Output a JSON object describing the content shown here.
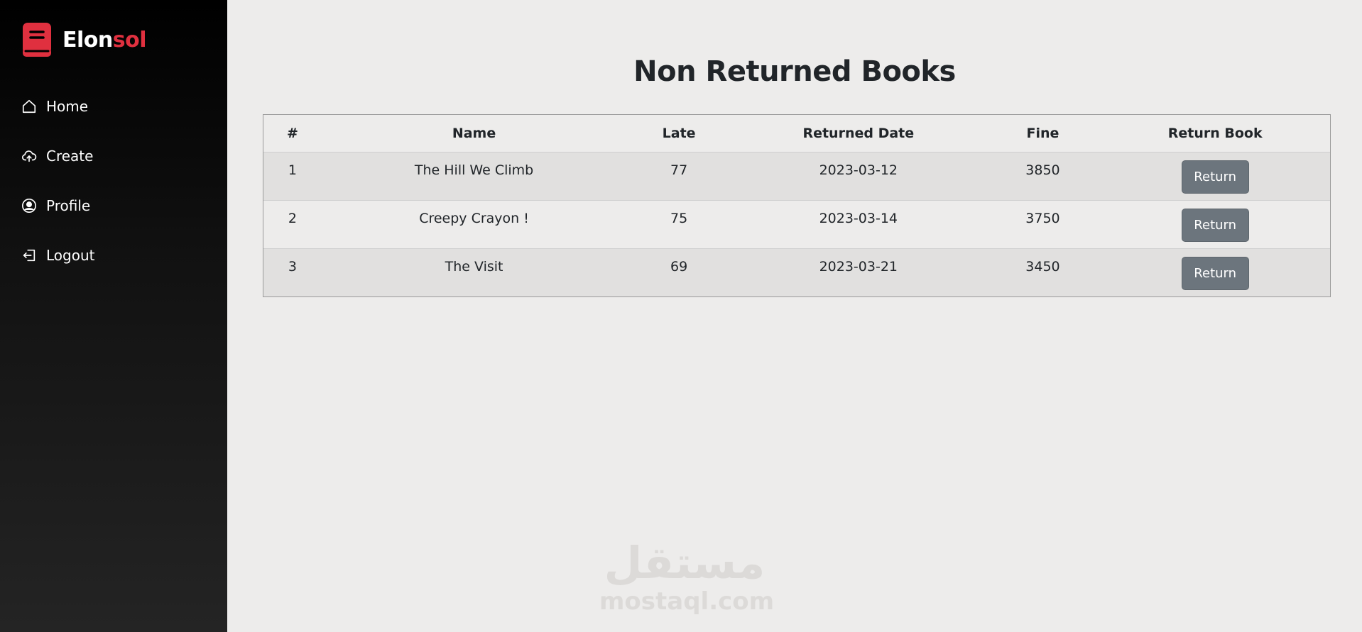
{
  "brand": {
    "name_part1": "Elon",
    "name_part2": "sol",
    "icon": "book-icon",
    "accent_color": "#e0303f"
  },
  "sidebar": {
    "items": [
      {
        "label": "Home",
        "icon": "home-icon"
      },
      {
        "label": "Create",
        "icon": "cloud-upload-icon"
      },
      {
        "label": "Profile",
        "icon": "user-circle-icon"
      },
      {
        "label": "Logout",
        "icon": "logout-icon"
      }
    ]
  },
  "page": {
    "title": "Non Returned Books"
  },
  "table": {
    "headers": [
      "#",
      "Name",
      "Late",
      "Returned Date",
      "Fine",
      "Return Book"
    ],
    "rows": [
      {
        "num": "1",
        "name": "The Hill We Climb",
        "late": "77",
        "returned_date": "2023-03-12",
        "fine": "3850",
        "action": "Return"
      },
      {
        "num": "2",
        "name": "Creepy Crayon !",
        "late": "75",
        "returned_date": "2023-03-14",
        "fine": "3750",
        "action": "Return"
      },
      {
        "num": "3",
        "name": "The Visit",
        "late": "69",
        "returned_date": "2023-03-21",
        "fine": "3450",
        "action": "Return"
      }
    ]
  },
  "watermark": {
    "arabic": "مستقل",
    "latin": "mostaql.com"
  }
}
